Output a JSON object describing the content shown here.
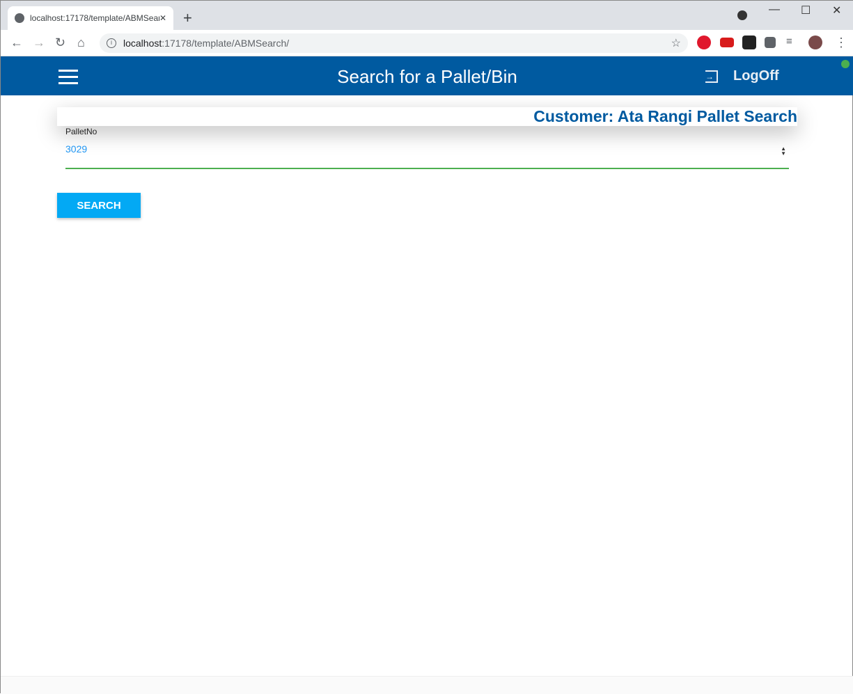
{
  "browser": {
    "tab_title": "localhost:17178/template/ABMSearch/",
    "url_host": "localhost",
    "url_path": ":17178/template/ABMSearch/",
    "new_tab": "+",
    "close": "✕"
  },
  "header": {
    "title": "Search for a Pallet/Bin",
    "logoff": "LogOff"
  },
  "card": {
    "customer": "Customer: Ata Rangi Pallet Search"
  },
  "form": {
    "label": "PalletNo",
    "value": "3029",
    "search_button": "SEARCH"
  },
  "colors": {
    "header": "#005aa0",
    "button": "#03a9f4",
    "underline": "#4caf50"
  }
}
